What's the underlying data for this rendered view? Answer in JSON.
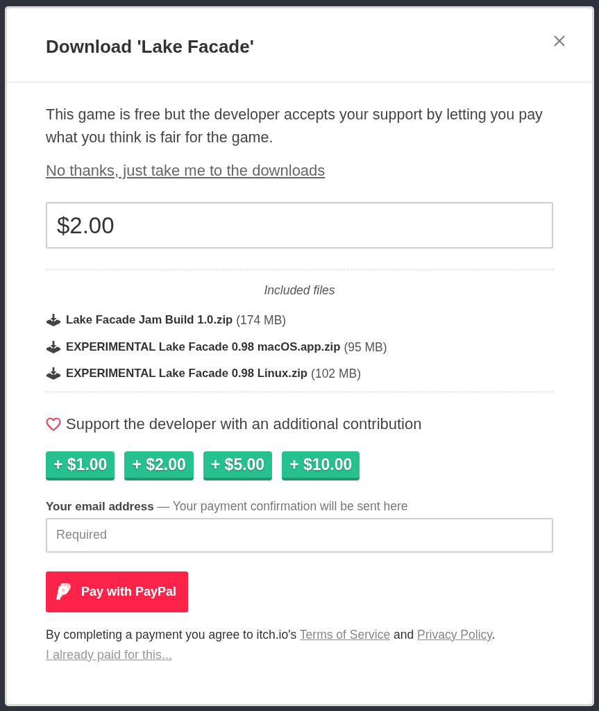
{
  "dialog": {
    "title": "Download 'Lake Facade'"
  },
  "intro": "This game is free but the developer accepts your support by letting you pay what you think is fair for the game.",
  "skip_link": "No thanks, just take me to the downloads",
  "price_field": {
    "value": "$2.00"
  },
  "files": {
    "heading": "Included files",
    "items": [
      {
        "name": "Lake Facade Jam Build 1.0.zip",
        "size": "(174 MB)"
      },
      {
        "name": "EXPERIMENTAL Lake Facade 0.98 macOS.app.zip",
        "size": "(95 MB)"
      },
      {
        "name": "EXPERIMENTAL Lake Facade 0.98 Linux.zip",
        "size": "(102 MB)"
      }
    ]
  },
  "support": {
    "text": "Support the developer with an additional contribution",
    "buttons": [
      "+ $1.00",
      "+ $2.00",
      "+ $5.00",
      "+ $10.00"
    ]
  },
  "email": {
    "label": "Your email address",
    "hint": "— Your payment confirmation will be sent here",
    "placeholder": "Required"
  },
  "pay_button": "Pay with PayPal",
  "agreement": [
    {
      "kind": "text",
      "text": "By completing a payment you agree to itch.io's "
    },
    {
      "kind": "link",
      "text": "Terms of Service"
    },
    {
      "kind": "text",
      "text": " and "
    },
    {
      "kind": "link",
      "text": "Privacy Policy"
    },
    {
      "kind": "text",
      "text": "."
    }
  ],
  "already_paid_link": "I already paid for this..."
}
